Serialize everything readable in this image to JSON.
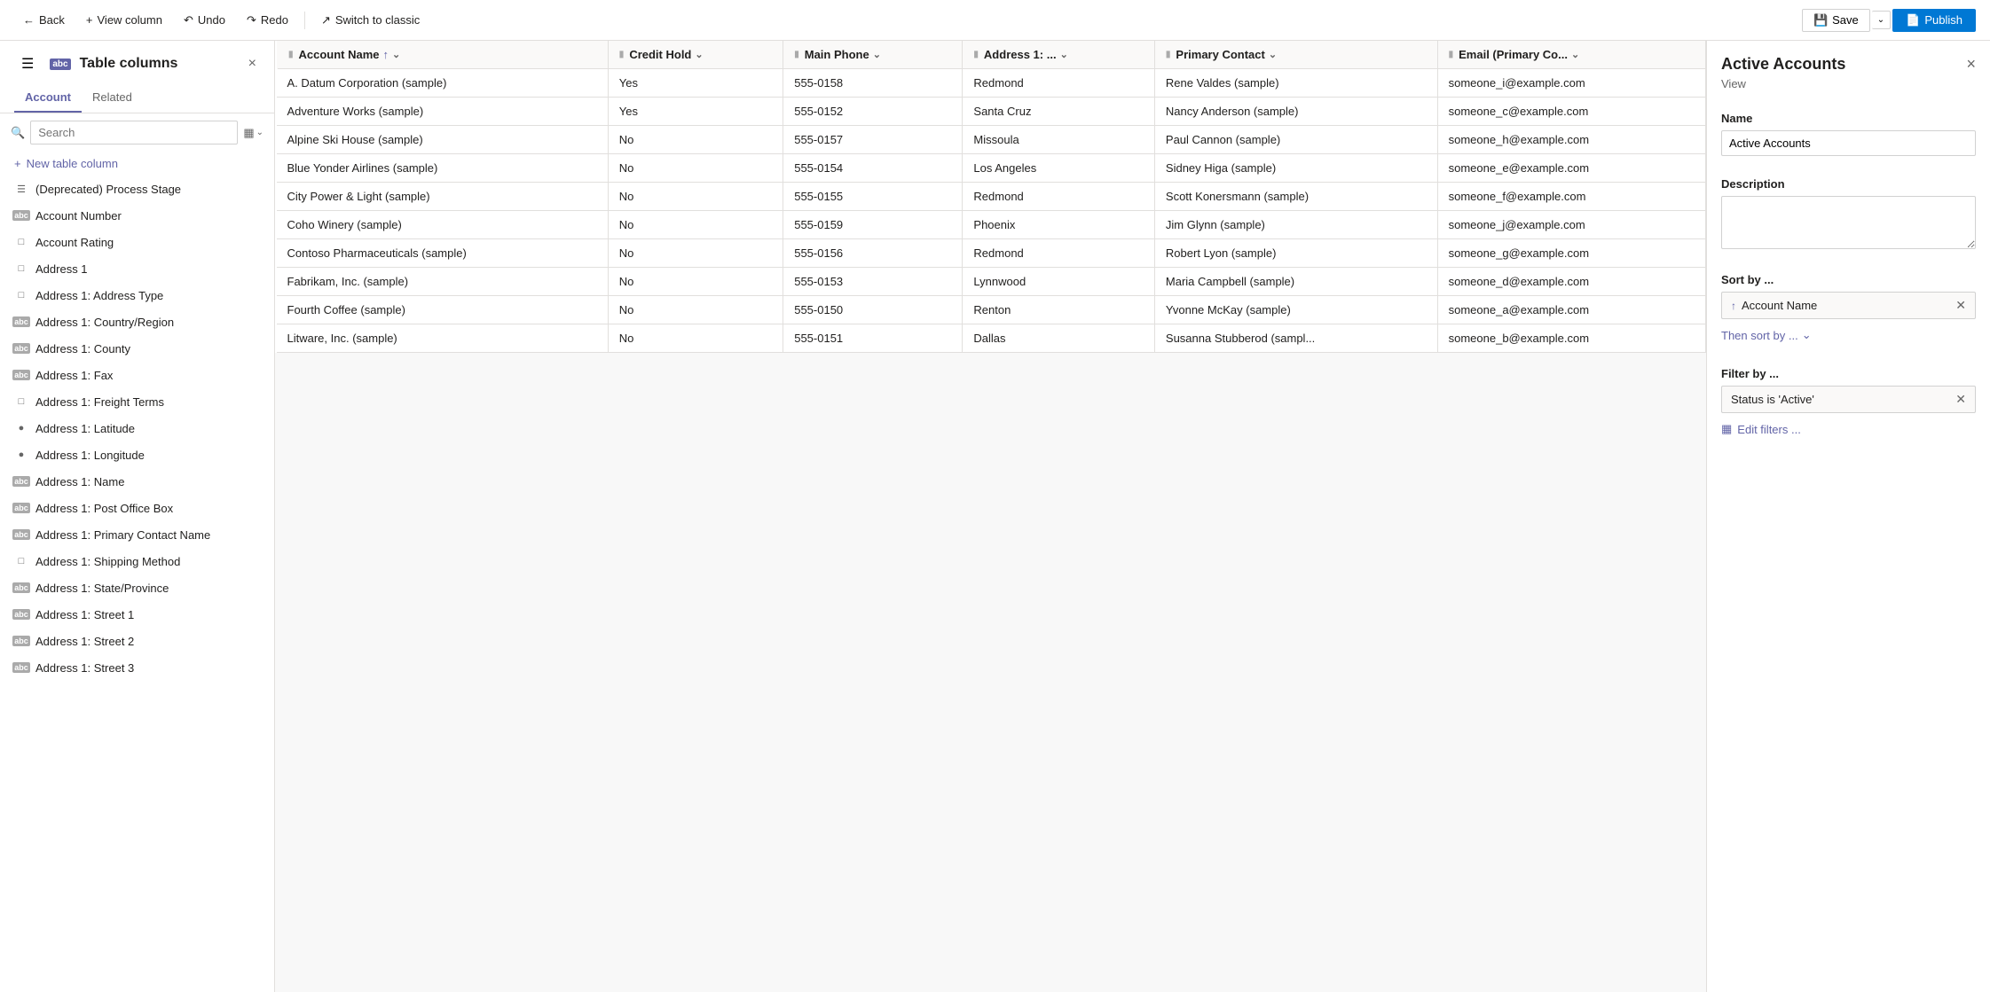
{
  "topbar": {
    "back_label": "Back",
    "view_column_label": "View column",
    "undo_label": "Undo",
    "redo_label": "Redo",
    "switch_label": "Switch to classic",
    "save_label": "Save",
    "publish_label": "Publish"
  },
  "sidebar": {
    "title": "Table columns",
    "close_label": "×",
    "tabs": [
      {
        "id": "account",
        "label": "Account"
      },
      {
        "id": "related",
        "label": "Related"
      }
    ],
    "active_tab": "account",
    "search_placeholder": "Search",
    "new_column_label": "New table column",
    "items": [
      {
        "id": "deprecated-process-stage",
        "label": "(Deprecated) Process Stage",
        "icon": "list"
      },
      {
        "id": "account-number",
        "label": "Account Number",
        "icon": "abc"
      },
      {
        "id": "account-rating",
        "label": "Account Rating",
        "icon": "box"
      },
      {
        "id": "address-1",
        "label": "Address 1",
        "icon": "box"
      },
      {
        "id": "address-1-address-type",
        "label": "Address 1: Address Type",
        "icon": "box"
      },
      {
        "id": "address-1-country-region",
        "label": "Address 1: Country/Region",
        "icon": "abc"
      },
      {
        "id": "address-1-county",
        "label": "Address 1: County",
        "icon": "abc"
      },
      {
        "id": "address-1-fax",
        "label": "Address 1: Fax",
        "icon": "abc"
      },
      {
        "id": "address-1-freight-terms",
        "label": "Address 1: Freight Terms",
        "icon": "box"
      },
      {
        "id": "address-1-latitude",
        "label": "Address 1: Latitude",
        "icon": "circle"
      },
      {
        "id": "address-1-longitude",
        "label": "Address 1: Longitude",
        "icon": "circle"
      },
      {
        "id": "address-1-name",
        "label": "Address 1: Name",
        "icon": "abc"
      },
      {
        "id": "address-1-post-office-box",
        "label": "Address 1: Post Office Box",
        "icon": "abc"
      },
      {
        "id": "address-1-primary-contact-name",
        "label": "Address 1: Primary Contact Name",
        "icon": "abc"
      },
      {
        "id": "address-1-shipping-method",
        "label": "Address 1: Shipping Method",
        "icon": "box"
      },
      {
        "id": "address-1-state-province",
        "label": "Address 1: State/Province",
        "icon": "abc"
      },
      {
        "id": "address-1-street-1",
        "label": "Address 1: Street 1",
        "icon": "abc"
      },
      {
        "id": "address-1-street-2",
        "label": "Address 1: Street 2",
        "icon": "abc"
      },
      {
        "id": "address-1-street-3",
        "label": "Address 1: Street 3",
        "icon": "abc"
      }
    ]
  },
  "table": {
    "columns": [
      {
        "id": "account-name",
        "label": "Account Name",
        "sortable": true
      },
      {
        "id": "credit-hold",
        "label": "Credit Hold",
        "sortable": true
      },
      {
        "id": "main-phone",
        "label": "Main Phone",
        "sortable": true
      },
      {
        "id": "address-1",
        "label": "Address 1: ...",
        "sortable": true
      },
      {
        "id": "primary-contact",
        "label": "Primary Contact",
        "sortable": true
      },
      {
        "id": "email-primary",
        "label": "Email (Primary Co...",
        "sortable": true
      }
    ],
    "rows": [
      {
        "account_name": "A. Datum Corporation (sample)",
        "credit_hold": "Yes",
        "main_phone": "555-0158",
        "address": "Redmond",
        "primary_contact": "Rene Valdes (sample)",
        "email": "someone_i@example.com"
      },
      {
        "account_name": "Adventure Works (sample)",
        "credit_hold": "Yes",
        "main_phone": "555-0152",
        "address": "Santa Cruz",
        "primary_contact": "Nancy Anderson (sample)",
        "email": "someone_c@example.com"
      },
      {
        "account_name": "Alpine Ski House (sample)",
        "credit_hold": "No",
        "main_phone": "555-0157",
        "address": "Missoula",
        "primary_contact": "Paul Cannon (sample)",
        "email": "someone_h@example.com"
      },
      {
        "account_name": "Blue Yonder Airlines (sample)",
        "credit_hold": "No",
        "main_phone": "555-0154",
        "address": "Los Angeles",
        "primary_contact": "Sidney Higa (sample)",
        "email": "someone_e@example.com"
      },
      {
        "account_name": "City Power & Light (sample)",
        "credit_hold": "No",
        "main_phone": "555-0155",
        "address": "Redmond",
        "primary_contact": "Scott Konersmann (sample)",
        "email": "someone_f@example.com"
      },
      {
        "account_name": "Coho Winery (sample)",
        "credit_hold": "No",
        "main_phone": "555-0159",
        "address": "Phoenix",
        "primary_contact": "Jim Glynn (sample)",
        "email": "someone_j@example.com"
      },
      {
        "account_name": "Contoso Pharmaceuticals (sample)",
        "credit_hold": "No",
        "main_phone": "555-0156",
        "address": "Redmond",
        "primary_contact": "Robert Lyon (sample)",
        "email": "someone_g@example.com"
      },
      {
        "account_name": "Fabrikam, Inc. (sample)",
        "credit_hold": "No",
        "main_phone": "555-0153",
        "address": "Lynnwood",
        "primary_contact": "Maria Campbell (sample)",
        "email": "someone_d@example.com"
      },
      {
        "account_name": "Fourth Coffee (sample)",
        "credit_hold": "No",
        "main_phone": "555-0150",
        "address": "Renton",
        "primary_contact": "Yvonne McKay (sample)",
        "email": "someone_a@example.com"
      },
      {
        "account_name": "Litware, Inc. (sample)",
        "credit_hold": "No",
        "main_phone": "555-0151",
        "address": "Dallas",
        "primary_contact": "Susanna Stubberod (sampl...",
        "email": "someone_b@example.com"
      }
    ]
  },
  "right_panel": {
    "title": "Active Accounts",
    "subtitle": "View",
    "close_label": "×",
    "name_label": "Name",
    "name_value": "Active Accounts",
    "description_label": "Description",
    "description_placeholder": "",
    "sort_label": "Sort by ...",
    "sort_item": "Account Name",
    "then_sort_label": "Then sort by ...",
    "filter_label": "Filter by ...",
    "filter_item": "Status is 'Active'",
    "edit_filters_label": "Edit filters ..."
  }
}
